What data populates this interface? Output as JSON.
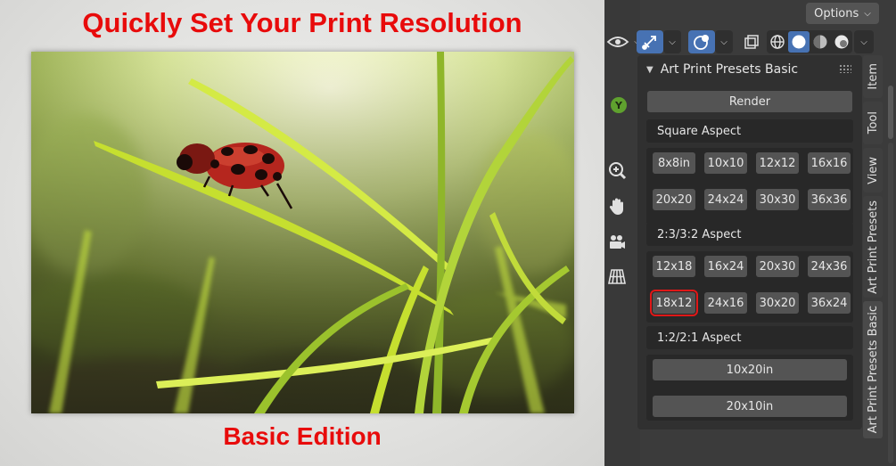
{
  "promo": {
    "title": "Quickly Set Your Print Resolution",
    "subtitle": "Basic Edition",
    "title_color": "#e80b0b"
  },
  "blender": {
    "options_label": "Options",
    "gizmo_axis_label": "Y",
    "panel_title": "Art Print Presets Basic",
    "render_label": "Render",
    "sections": [
      {
        "label": "Square Aspect",
        "rows": [
          [
            "8x8in",
            "10x10",
            "12x12",
            "16x16"
          ],
          [
            "20x20",
            "24x24",
            "30x30",
            "36x36"
          ]
        ]
      },
      {
        "label": "2:3/3:2 Aspect",
        "rows": [
          [
            "12x18",
            "16x24",
            "20x30",
            "24x36"
          ],
          [
            "18x12",
            "24x16",
            "30x20",
            "36x24"
          ]
        ]
      },
      {
        "label": "1:2/2:1 Aspect",
        "wide": [
          "10x20in",
          "20x10in"
        ]
      }
    ],
    "selected_preset": "18x12",
    "tabs": [
      "Item",
      "Tool",
      "View",
      "Art Print Presets",
      "Art Print Presets Basic"
    ],
    "active_tab": "Art Print Presets Basic",
    "accent_color": "#4772b3",
    "selection_outline_color": "#e01818"
  }
}
